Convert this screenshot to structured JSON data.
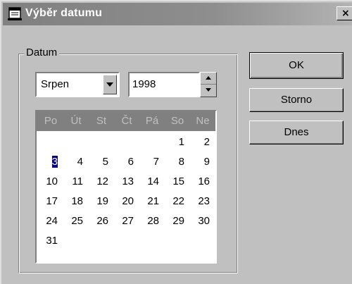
{
  "window": {
    "title": "Výběr datumu",
    "close_glyph": "×",
    "icon": "calendar-window-icon"
  },
  "group": {
    "label": "Datum"
  },
  "month": {
    "selected": "Srpen"
  },
  "year": {
    "value": "1998"
  },
  "calendar": {
    "weekdays": [
      "Po",
      "Út",
      "St",
      "Čt",
      "Pá",
      "So",
      "Ne"
    ],
    "weeks": [
      [
        "",
        "",
        "",
        "",
        "",
        "1",
        "2"
      ],
      [
        "3",
        "4",
        "5",
        "6",
        "7",
        "8",
        "9"
      ],
      [
        "10",
        "11",
        "12",
        "13",
        "14",
        "15",
        "16"
      ],
      [
        "17",
        "18",
        "19",
        "20",
        "21",
        "22",
        "23"
      ],
      [
        "24",
        "25",
        "26",
        "27",
        "28",
        "29",
        "30"
      ],
      [
        "31",
        "",
        "",
        "",
        "",
        "",
        ""
      ]
    ],
    "selected_day": "3"
  },
  "buttons": {
    "ok": "OK",
    "cancel": "Storno",
    "today": "Dnes"
  },
  "colors": {
    "face": "#c0c0c0",
    "selection": "#000080",
    "calendar_header": "#808080",
    "titlebar": "#808080"
  }
}
